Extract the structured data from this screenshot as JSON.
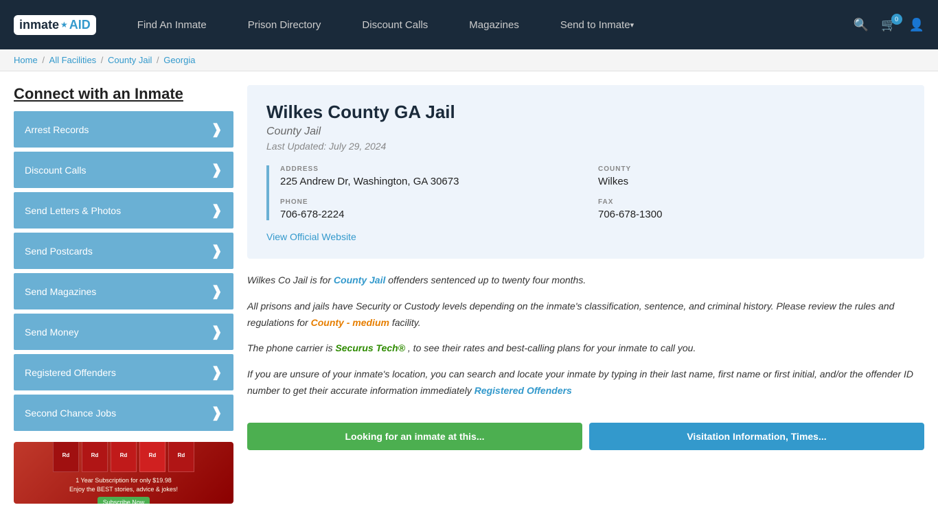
{
  "header": {
    "logo": {
      "inmate": "inmate",
      "star": "★",
      "aid": "AID"
    },
    "nav": [
      {
        "label": "Find An Inmate",
        "has_arrow": false
      },
      {
        "label": "Prison Directory",
        "has_arrow": false
      },
      {
        "label": "Discount Calls",
        "has_arrow": false
      },
      {
        "label": "Magazines",
        "has_arrow": false
      },
      {
        "label": "Send to Inmate",
        "has_arrow": true
      }
    ],
    "cart_count": "0"
  },
  "breadcrumb": {
    "items": [
      "Home",
      "All Facilities",
      "County Jail",
      "Georgia"
    ]
  },
  "sidebar": {
    "title": "Connect with an Inmate",
    "items": [
      "Arrest Records",
      "Discount Calls",
      "Send Letters & Photos",
      "Send Postcards",
      "Send Magazines",
      "Send Money",
      "Registered Offenders",
      "Second Chance Jobs"
    ],
    "ad_title": "Reader's Digest",
    "ad_line1": "1 Year Subscription for only $19.98",
    "ad_line2": "Enjoy the BEST stories, advice & jokes!",
    "ad_subscribe": "Subscribe Now"
  },
  "facility": {
    "name": "Wilkes County GA Jail",
    "type": "County Jail",
    "last_updated": "Last Updated: July 29, 2024",
    "address_label": "ADDRESS",
    "address_value": "225 Andrew Dr, Washington, GA 30673",
    "county_label": "COUNTY",
    "county_value": "Wilkes",
    "phone_label": "PHONE",
    "phone_value": "706-678-2224",
    "fax_label": "FAX",
    "fax_value": "706-678-1300",
    "official_link": "View Official Website"
  },
  "descriptions": [
    {
      "text_before": "Wilkes Co Jail is for ",
      "link_text": "County Jail",
      "link_color": "blue",
      "text_after": " offenders sentenced up to twenty four months."
    },
    {
      "text_before": "All prisons and jails have Security or Custody levels depending on the inmate’s classification, sentence, and criminal history. Please review the rules and regulations for ",
      "link_text": "County - medium",
      "link_color": "orange",
      "text_after": " facility."
    },
    {
      "text_before": "The phone carrier is ",
      "link_text": "Securus Tech®",
      "link_color": "green",
      "text_after": ", to see their rates and best-calling plans for your inmate to call you."
    },
    {
      "text_before": "If you are unsure of your inmate’s location, you can search and locate your inmate by typing in their last name, first name or first initial, and/or the offender ID number to get their accurate information immediately ",
      "link_text": "Registered Offenders",
      "link_color": "blue",
      "text_after": ""
    }
  ],
  "bottom_buttons": [
    {
      "label": "Looking for an inmate at this...",
      "color": "green"
    },
    {
      "label": "Visitation Information, Times...",
      "color": "blue"
    }
  ]
}
